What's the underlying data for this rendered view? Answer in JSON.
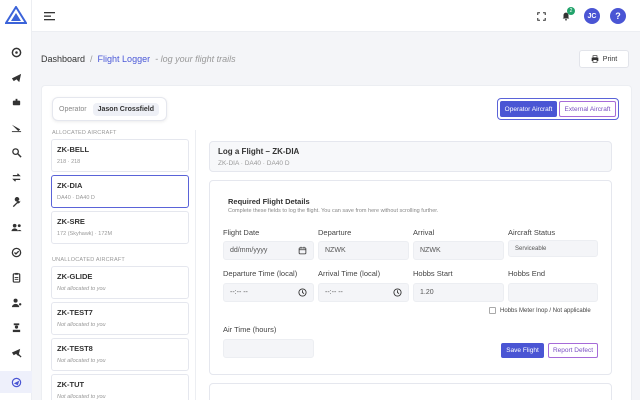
{
  "sidebar": {
    "logo_color": "#3b63d9",
    "items": [
      {
        "icon": "dashboard-icon",
        "active": false
      },
      {
        "icon": "plane-icon",
        "active": false
      },
      {
        "icon": "tracker-icon",
        "active": false
      },
      {
        "icon": "plane-landing-icon",
        "active": false
      },
      {
        "icon": "search-plane-icon",
        "active": false
      },
      {
        "icon": "repeat-icon",
        "active": false
      },
      {
        "icon": "wrench-icon",
        "active": false
      },
      {
        "icon": "users-icon",
        "active": false
      },
      {
        "icon": "check-circle-icon",
        "active": false
      },
      {
        "icon": "clipboard-icon",
        "active": false
      },
      {
        "icon": "user-settings-icon",
        "active": false
      },
      {
        "icon": "pilot-icon",
        "active": false
      },
      {
        "icon": "plane-tools-icon",
        "active": false
      },
      {
        "icon": "flight-log-icon",
        "active": true
      }
    ]
  },
  "topbar": {
    "notification_count": "2",
    "user_initials": "JC",
    "help_label": "?",
    "avatar_color": "#4a55d4"
  },
  "breadcrumb": {
    "home": "Dashboard",
    "separator": "/",
    "current": "Flight Logger",
    "subtitle": "- log your flight trails"
  },
  "print_label": "Print",
  "operator": {
    "label": "Operator",
    "name": "Jason Crossfield"
  },
  "aircraft_toggle": {
    "operator": "Operator Aircraft",
    "external": "External Aircraft"
  },
  "allocated": {
    "heading": "Allocated Aircraft",
    "items": [
      {
        "reg": "ZK-BELL",
        "desc": "218 · 218"
      },
      {
        "reg": "ZK-DIA",
        "desc": "DA40 · DA40 D"
      },
      {
        "reg": "ZK-SRE",
        "desc": "172 (Skyhawk) · 172M"
      }
    ]
  },
  "unallocated": {
    "heading": "Unallocated Aircraft",
    "items": [
      {
        "reg": "ZK-GLIDE",
        "desc": "Not allocated to you"
      },
      {
        "reg": "ZK-TEST7",
        "desc": "Not allocated to you"
      },
      {
        "reg": "ZK-TEST8",
        "desc": "Not allocated to you"
      },
      {
        "reg": "ZK-TUT",
        "desc": "Not allocated to you"
      }
    ]
  },
  "log_header": {
    "title": "Log a Flight – ZK-DIA",
    "subtitle": "ZK-DIA · DA40 · DA40 D"
  },
  "details": {
    "title": "Required Flight Details",
    "subtitle": "Complete these fields to log the flight. You can save from here without scrolling further.",
    "fields": {
      "flight_date": {
        "label": "Flight Date",
        "value": "dd/mm/yyyy"
      },
      "departure": {
        "label": "Departure",
        "value": "NZWK"
      },
      "arrival": {
        "label": "Arrival",
        "value": "NZWK"
      },
      "aircraft_status": {
        "label": "Aircraft Status",
        "value": "Serviceable"
      },
      "departure_time": {
        "label": "Departure Time (local)",
        "value": "--:-- --"
      },
      "arrival_time": {
        "label": "Arrival Time (local)",
        "value": "--:-- --"
      },
      "hobbs_start": {
        "label": "Hobbs Start",
        "value": "1.20"
      },
      "hobbs_end": {
        "label": "Hobbs End",
        "value": ""
      },
      "air_time": {
        "label": "Air Time (hours)",
        "value": ""
      }
    },
    "hobbs_inop_label": "Hobbs Meter Inop / Not applicable",
    "save_label": "Save Flight",
    "report_label": "Report Defect"
  }
}
